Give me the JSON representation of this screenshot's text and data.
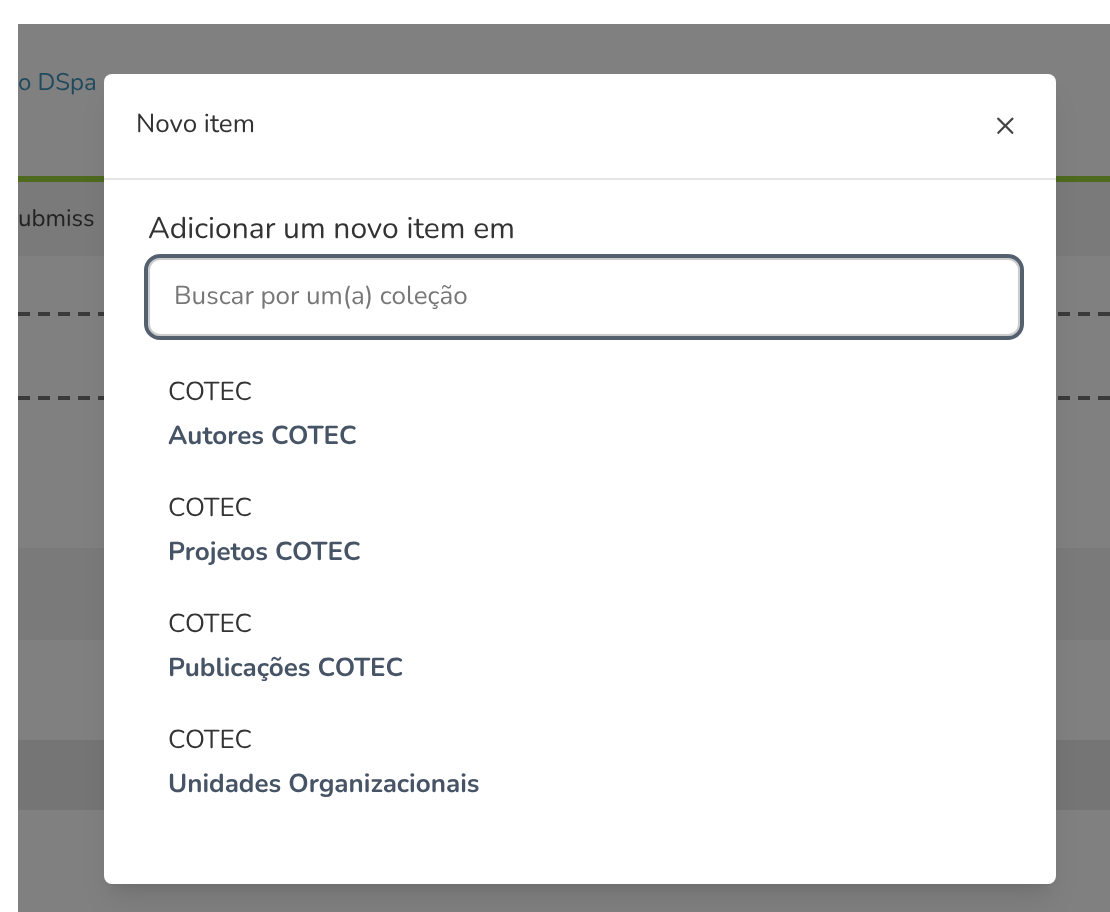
{
  "background": {
    "link_text": "o DSpa",
    "column_text": "ubmiss"
  },
  "dialog": {
    "title": "Novo item",
    "close": "×",
    "label": "Adicionar um novo item em",
    "search": {
      "placeholder": "Buscar por um(a) coleção"
    },
    "items": [
      {
        "parent": "COTEC",
        "name": "Autores COTEC"
      },
      {
        "parent": "COTEC",
        "name": "Projetos COTEC"
      },
      {
        "parent": "COTEC",
        "name": "Publicações COTEC"
      },
      {
        "parent": "COTEC",
        "name": "Unidades Organizacionais"
      }
    ]
  }
}
